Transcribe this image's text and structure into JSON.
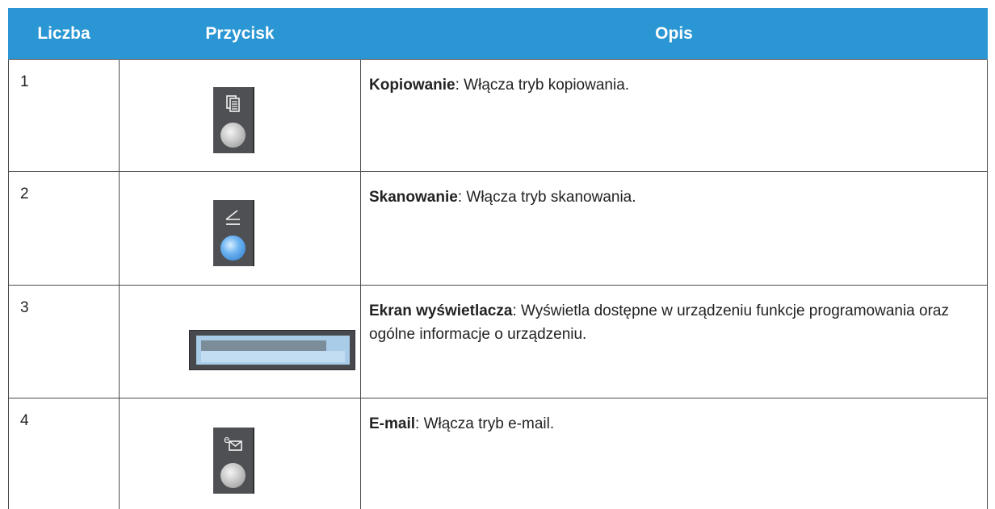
{
  "table": {
    "headers": {
      "number": "Liczba",
      "button": "Przycisk",
      "description": "Opis"
    },
    "rows": [
      {
        "number": "1",
        "icon": "copy-icon",
        "title": "Kopiowanie",
        "text": ": Włącza tryb kopiowania."
      },
      {
        "number": "2",
        "icon": "scan-icon",
        "title": "Skanowanie",
        "text": ": Włącza tryb skanowania."
      },
      {
        "number": "3",
        "icon": "display-screen-icon",
        "title": "Ekran wyświetlacza",
        "text": ": Wyświetla dostępne w urządzeniu funkcje programowania oraz ogólne informacje o urządzeniu."
      },
      {
        "number": "4",
        "icon": "email-icon",
        "title": "E-mail",
        "text": ": Włącza tryb e-mail."
      }
    ]
  },
  "colors": {
    "header_background": "#2B96D4",
    "header_text": "#FFFFFF",
    "button_body": "#4E5054",
    "scan_knob": "#6CB3F2",
    "screen_lcd": "#A9CDE9"
  }
}
